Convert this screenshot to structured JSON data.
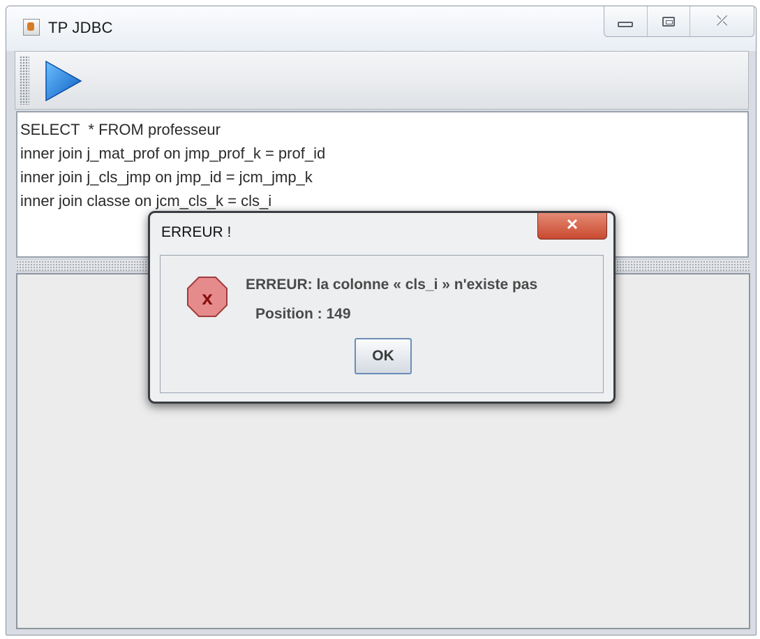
{
  "window": {
    "title": "TP JDBC",
    "caption_buttons": {
      "minimize": "minimize",
      "maximize": "maximize",
      "close": "⤫"
    }
  },
  "toolbar": {
    "run_icon": "play-icon"
  },
  "editor": {
    "lines": [
      "SELECT  * FROM professeur",
      "inner join j_mat_prof on jmp_prof_k = prof_id",
      "inner join j_cls_jmp on jmp_id = jcm_jmp_k",
      "inner join classe on jcm_cls_k = cls_i"
    ]
  },
  "dialog": {
    "title": "ERREUR !",
    "close_label": "✕",
    "message": "ERREUR: la colonne « cls_i » n'existe pas",
    "position": "Position : 149",
    "ok_label": "OK",
    "icon": "error-icon"
  },
  "colors": {
    "close_button": "#c84a30",
    "error_icon": "#e07070",
    "play_icon": "#1e78d8"
  }
}
